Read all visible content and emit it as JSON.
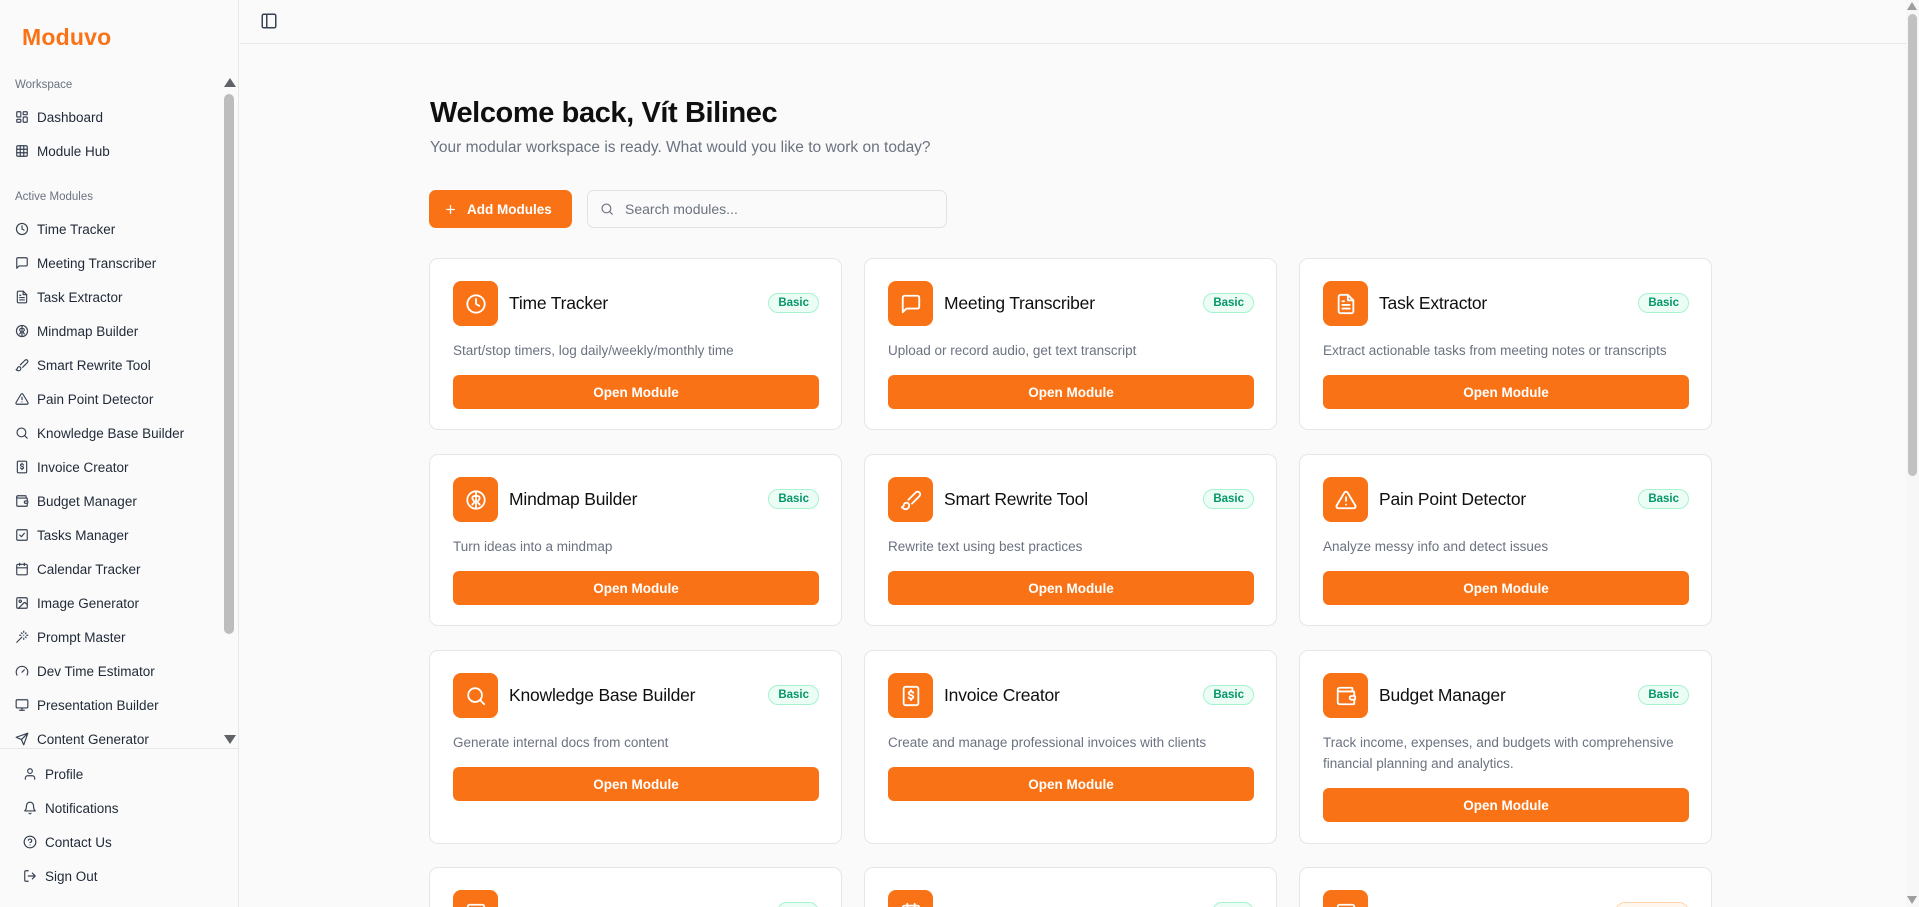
{
  "brand": "Moduvo",
  "sidebar": {
    "workspace_label": "Workspace",
    "workspace_items": [
      {
        "label": "Dashboard",
        "icon": "dashboard-icon"
      },
      {
        "label": "Module Hub",
        "icon": "grid-icon"
      }
    ],
    "active_label": "Active Modules",
    "active_items": [
      {
        "label": "Time Tracker",
        "icon": "clock-icon"
      },
      {
        "label": "Meeting Transcriber",
        "icon": "message-icon"
      },
      {
        "label": "Task Extractor",
        "icon": "file-text-icon"
      },
      {
        "label": "Mindmap Builder",
        "icon": "brain-icon"
      },
      {
        "label": "Smart Rewrite Tool",
        "icon": "brush-icon"
      },
      {
        "label": "Pain Point Detector",
        "icon": "alert-triangle-icon"
      },
      {
        "label": "Knowledge Base Builder",
        "icon": "search-icon"
      },
      {
        "label": "Invoice Creator",
        "icon": "invoice-icon"
      },
      {
        "label": "Budget Manager",
        "icon": "wallet-icon"
      },
      {
        "label": "Tasks Manager",
        "icon": "checkbox-icon"
      },
      {
        "label": "Calendar Tracker",
        "icon": "calendar-icon"
      },
      {
        "label": "Image Generator",
        "icon": "image-icon"
      },
      {
        "label": "Prompt Master",
        "icon": "wand-icon"
      },
      {
        "label": "Dev Time Estimator",
        "icon": "gauge-icon"
      },
      {
        "label": "Presentation Builder",
        "icon": "presentation-icon"
      },
      {
        "label": "Content Generator",
        "icon": "send-icon"
      }
    ],
    "footer": [
      {
        "label": "Profile",
        "icon": "user-icon"
      },
      {
        "label": "Notifications",
        "icon": "bell-icon"
      },
      {
        "label": "Contact Us",
        "icon": "help-circle-icon"
      },
      {
        "label": "Sign Out",
        "icon": "logout-icon"
      }
    ]
  },
  "main": {
    "welcome": "Welcome back, Vít Bilinec",
    "subtitle": "Your modular workspace is ready. What would you like to work on today?",
    "add_button": "Add Modules",
    "search_placeholder": "Search modules...",
    "cards": [
      {
        "title": "Time Tracker",
        "badge": "Basic",
        "desc": "Start/stop timers, log daily/weekly/monthly time",
        "button": "Open Module",
        "icon": "clock-icon"
      },
      {
        "title": "Meeting Transcriber",
        "badge": "Basic",
        "desc": "Upload or record audio, get text transcript",
        "button": "Open Module",
        "icon": "message-icon"
      },
      {
        "title": "Task Extractor",
        "badge": "Basic",
        "desc": "Extract actionable tasks from meeting notes or transcripts",
        "button": "Open Module",
        "icon": "file-text-icon"
      },
      {
        "title": "Mindmap Builder",
        "badge": "Basic",
        "desc": "Turn ideas into a mindmap",
        "button": "Open Module",
        "icon": "brain-icon"
      },
      {
        "title": "Smart Rewrite Tool",
        "badge": "Basic",
        "desc": "Rewrite text using best practices",
        "button": "Open Module",
        "icon": "brush-icon"
      },
      {
        "title": "Pain Point Detector",
        "badge": "Basic",
        "desc": "Analyze messy info and detect issues",
        "button": "Open Module",
        "icon": "alert-triangle-icon"
      },
      {
        "title": "Knowledge Base Builder",
        "badge": "Basic",
        "desc": "Generate internal docs from content",
        "button": "Open Module",
        "icon": "search-icon"
      },
      {
        "title": "Invoice Creator",
        "badge": "Basic",
        "desc": "Create and manage professional invoices with clients",
        "button": "Open Module",
        "icon": "invoice-icon"
      },
      {
        "title": "Budget Manager",
        "badge": "Basic",
        "desc": "Track income, expenses, and budgets with comprehensive financial planning and analytics.",
        "button": "Open Module",
        "icon": "wallet-icon"
      }
    ],
    "partial_cards": [
      {
        "icon": "checkbox-icon",
        "badge_color": "green"
      },
      {
        "icon": "calendar-icon",
        "badge_color": "green"
      },
      {
        "icon": "image-icon",
        "badge_color": "orange"
      }
    ]
  },
  "colors": {
    "accent": "#f97316",
    "badge_green": "#059669",
    "badge_orange": "#ea580c"
  }
}
